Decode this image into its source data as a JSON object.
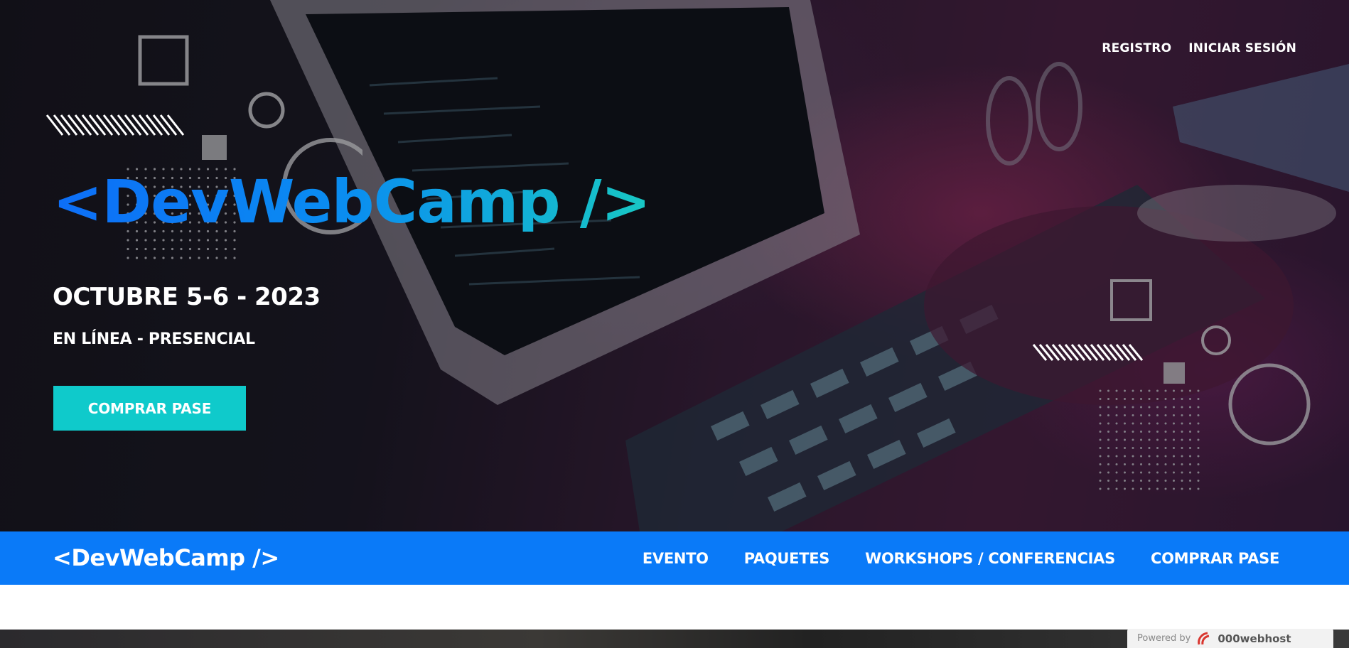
{
  "header": {
    "links": [
      {
        "label": "REGISTRO"
      },
      {
        "label": "INICIAR SESIÓN"
      }
    ]
  },
  "hero": {
    "logo": "<DevWebCamp />",
    "date": "OCTUBRE 5-6 - 2023",
    "mode": "EN LÍNEA - PRESENCIAL",
    "cta_label": "COMPRAR PASE"
  },
  "navbar": {
    "logo": "<DevWebCamp />",
    "items": [
      {
        "label": "EVENTO"
      },
      {
        "label": "PAQUETES"
      },
      {
        "label": "WORKSHOPS / CONFERENCIAS"
      },
      {
        "label": "COMPRAR PASE"
      }
    ]
  },
  "footer_badge": {
    "powered_by": "Powered by",
    "brand": "000webhost"
  },
  "colors": {
    "nav_blue": "#0a7af8",
    "cta_teal": "#0fcacb",
    "logo_gradient_start": "#0d6ef7",
    "logo_gradient_end": "#18c8c4"
  }
}
